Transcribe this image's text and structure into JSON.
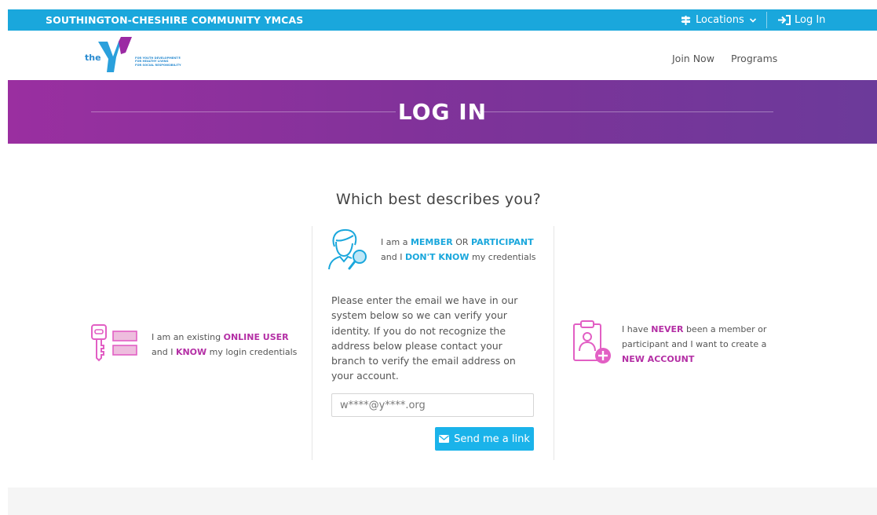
{
  "topbar": {
    "brand": "SOUTHINGTON-CHESHIRE COMMUNITY YMCAS",
    "locations_label": "Locations",
    "login_label": "Log In"
  },
  "logo": {
    "the_text": "the",
    "tagline_1": "FOR YOUTH DEVELOPMENT®",
    "tagline_2": "FOR HEALTHY LIVING",
    "tagline_3": "FOR SOCIAL RESPONSIBILITY"
  },
  "nav": {
    "join_now": "Join Now",
    "programs": "Programs"
  },
  "banner": {
    "title": "LOG IN"
  },
  "question": "Which best describes you?",
  "options": {
    "existing": {
      "line1_pre": "I am an existing ",
      "line1_hl": "ONLINE USER",
      "line2_pre": "and I ",
      "line2_hl": "KNOW",
      "line2_post": " my login credentials"
    },
    "member": {
      "line1_pre": "I am a ",
      "line1_hl1": "MEMBER",
      "line1_mid": " OR ",
      "line1_hl2": "PARTICIPANT",
      "line2_pre": "and I ",
      "line2_hl": "DON'T KNOW",
      "line2_post": " my credentials"
    },
    "new": {
      "line1_pre": "I have ",
      "line1_hl": "NEVER",
      "line1_post": " been a member or",
      "line2": "participant and I want to create a",
      "line3_hl": "NEW ACCOUNT"
    }
  },
  "verify": {
    "paragraph": "Please enter the email we have in our system below so we can verify your identity. If you do not recognize the address below please contact your branch to verify the email address on your account.",
    "email_value": "w****@y****.org",
    "send_label": "Send me a link"
  },
  "colors": {
    "accent_cyan": "#1aa7dc",
    "accent_pink": "#b42fa5",
    "banner_purple": "#7d3399"
  }
}
